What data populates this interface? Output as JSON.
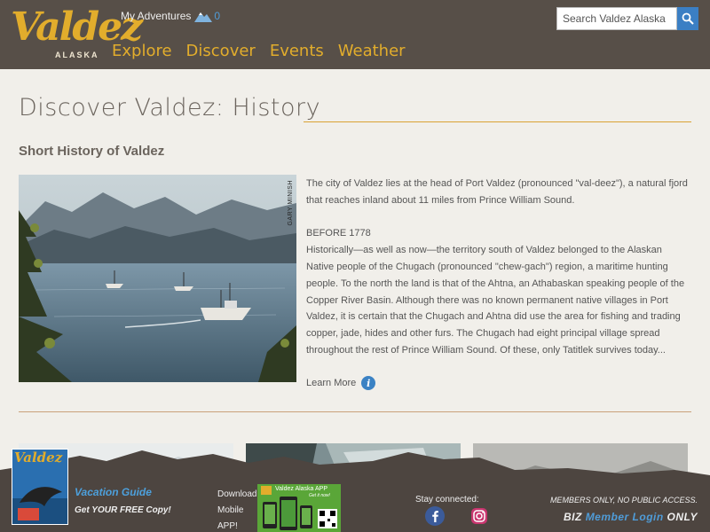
{
  "header": {
    "logo_word": "Valdez",
    "logo_sub": "ALASKA",
    "my_adventures_label": "My Adventures",
    "my_adventures_count": "0",
    "nav": [
      "Explore",
      "Discover",
      "Events",
      "Weather"
    ],
    "search_placeholder": "Search Valdez Alaska",
    "brand_color": "#e2ad2c",
    "bar_color": "#574f48"
  },
  "main": {
    "title": "Discover Valdez: History",
    "subtitle": "Short History of Valdez",
    "photo_credit": "GARY MINISH",
    "paragraph1": "The city of Valdez lies at the head of Port Valdez (pronounced \"val-deez\"), a natural fjord that reaches inland about 11 miles from Prince William Sound.",
    "era_heading": "BEFORE 1778",
    "paragraph2": "Historically—as well as now—the territory south of Valdez belonged to the Alaskan Native people of the Chugach (pronounced \"chew-gach\") region, a maritime hunting people. To the north the land is that of the Ahtna, an Athabaskan speaking people of the Copper River Basin. Although there was no known permanent native villages in Port Valdez, it is certain that the Chugach and Ahtna did use the area for fishing and trading copper, jade, hides and other furs. The Chugach had eight principal village spread throughout the rest of Prince William Sound. Of these, only Tatitlek survives today...",
    "learn_more": "Learn More"
  },
  "footer": {
    "guide_cover_word": "Valdez",
    "guide_title": "Vacation Guide",
    "guide_sub": "Get YOUR FREE Copy!",
    "download_lines": [
      "Download",
      "Mobile",
      "APP!"
    ],
    "app_title": "Valdez Alaska APP",
    "app_sub": "Get it now!",
    "stay_connected": "Stay connected:",
    "members_note": "MEMBERS ONLY, NO PUBLIC ACCESS.",
    "login_prefix": "BIZ",
    "login_link": "Member Login",
    "login_suffix": "ONLY"
  }
}
